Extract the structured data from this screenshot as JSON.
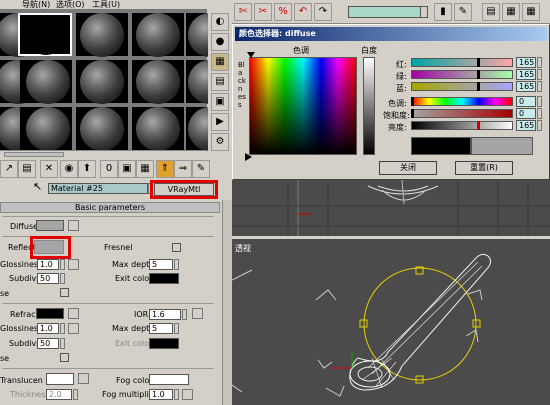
{
  "menu": {
    "nav": "导航(N)",
    "options": "选项(O)",
    "tools": "工具(U)"
  },
  "material": {
    "name": "Material #25",
    "type_button": "VRayMtl",
    "rollout_title": "Basic parameters"
  },
  "params": {
    "diffuse": "Diffuse",
    "reflect": "Reflect",
    "fresnel": "Fresnel",
    "glossiness": "Glossiness",
    "glossiness_value": "1.0",
    "max_depth": "Max depth",
    "max_depth_value": "5",
    "subdivs": "Subdivs",
    "subdivs_value": "50",
    "exit_color": "Exit color",
    "use": "se",
    "refract": "Refract",
    "ior": "IOR",
    "ior_value": "1.6",
    "refract_glossiness_value": "1.0",
    "refract_max_depth_value": "5",
    "refract_subdivs_value": "50",
    "refract_exit_color": "Exit color",
    "use2": "se",
    "translucent": "Translucen",
    "thickness": "Thickness",
    "thickness_value": "2.0",
    "fog_color": "Fog color",
    "fog_multiplier": "Fog multiplier",
    "fog_multiplier_value": "1.0"
  },
  "color_dialog": {
    "title": "颜色选择器: diffuse",
    "hue": "色调",
    "whiteness": "白度",
    "blackness": "Blackness",
    "red": "红:",
    "green": "绿:",
    "blue": "蓝:",
    "hue2": "色调:",
    "saturation": "饱和度:",
    "value": "亮度:",
    "red_value": "165",
    "green_value": "165",
    "blue_value": "165",
    "hue_value": "0",
    "saturation_value": "0",
    "value_value": "165",
    "close": "关闭",
    "reset": "重置(R)"
  },
  "viewport": {
    "persp_label": "透视"
  },
  "colors": {
    "selected_color": "#a5a5a5",
    "accent_red": "#e00000",
    "dialog_title": "#0a246a",
    "viewport_bg": "#4b4b4b"
  }
}
